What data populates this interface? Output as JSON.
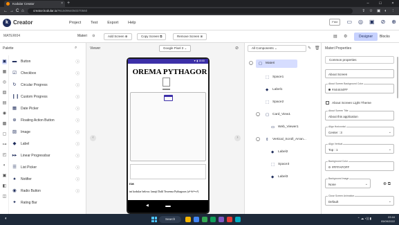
{
  "browser": {
    "tab_title": "Kodular Creator",
    "tab_close": "×",
    "new_tab": "+",
    "win_minimize": "–",
    "win_restore": "□",
    "win_close": "×",
    "back": "←",
    "forward": "→",
    "reload": "C",
    "home": "⌂",
    "url_host": "creator.kodular.io",
    "url_rest": "/#6150964050370560",
    "addr_icons": [
      "⇪",
      "☆",
      "▣",
      "◐",
      "⋮"
    ]
  },
  "app": {
    "logo_letter": "k",
    "brand": "Creator",
    "menu": [
      "Project",
      "Test",
      "Export",
      "Help"
    ],
    "free_badge": "Free",
    "header_icons": [
      "▭",
      "◎",
      "▣",
      "⊘",
      "⊕"
    ]
  },
  "toolbar": {
    "project_name": "MATERI04",
    "screen_name": "Materi",
    "screen_icon": "⊙",
    "add_screen": "Add Screen ⊕",
    "copy_screen": "Copy Screen ⧉",
    "remove_screen": "Remove Screen ⊗",
    "tool_icons": [
      "▤",
      "⚙"
    ],
    "designer": "Designer",
    "blocks": "Blocks"
  },
  "palette": {
    "title": "Palette",
    "search_icon": "⌕",
    "rail_icons": [
      "▣",
      "▦",
      "◎",
      "▨",
      "▤",
      "◉",
      "▩",
      "▢",
      "⊶",
      "◰",
      "◐",
      "▣",
      "◧",
      "◫"
    ],
    "help_icon": "ⓘ",
    "items": [
      {
        "icon": "▬",
        "label": "Button"
      },
      {
        "icon": "☑",
        "label": "Checkbox"
      },
      {
        "icon": "↻",
        "label": "Circular Progress"
      },
      {
        "icon": "❙❙",
        "label": "Custom Progress"
      },
      {
        "icon": "▦",
        "label": "Date Picker"
      },
      {
        "icon": "⊕",
        "label": "Floating Action Button"
      },
      {
        "icon": "▨",
        "label": "Image"
      },
      {
        "icon": "◆",
        "label": "Label"
      },
      {
        "icon": "▸▸",
        "label": "Linear Progressbar"
      },
      {
        "icon": "☰",
        "label": "List Picker"
      },
      {
        "icon": "♠",
        "label": "Notifier"
      },
      {
        "icon": "◉",
        "label": "Radio Button"
      },
      {
        "icon": "✦",
        "label": "Rating Bar"
      }
    ]
  },
  "viewer": {
    "title": "Viewer",
    "device": "Google Pixel 3 ⌄",
    "side_icon": "⊘",
    "scroll_left": "‹",
    "scroll_right": "›",
    "status_icons": "▼ ▮ 10:00",
    "screen_title": "OREMA PYTHAGOR",
    "text_heading": "ras",
    "text_body": "ini kodular belova. lanuji Dalil Teorema Pythagoras (a²+b²=c²)",
    "nav_back": "◀"
  },
  "components": {
    "title": "All Components ⌄",
    "edit_icon": "✎",
    "delete_icon": "🗑",
    "tree": [
      {
        "icon": "▢",
        "label": "Materi",
        "selected": true,
        "toggle": "–",
        "indent": 0
      },
      {
        "icon": "⬚",
        "label": "Space1",
        "selected": false,
        "toggle": "",
        "indent": 1
      },
      {
        "icon": "◆",
        "label": "Label1",
        "selected": false,
        "toggle": "",
        "indent": 1
      },
      {
        "icon": "⬚",
        "label": "Space2",
        "selected": false,
        "toggle": "",
        "indent": 1
      },
      {
        "icon": "▢",
        "label": "Card_View1",
        "selected": false,
        "toggle": "–",
        "indent": 1
      },
      {
        "icon": "▭",
        "label": "Web_Viewer1",
        "selected": false,
        "toggle": "",
        "indent": 2
      },
      {
        "icon": "⇕",
        "label": "Vertical_Scroll_Arran...",
        "selected": false,
        "toggle": "–",
        "indent": 1
      },
      {
        "icon": "◆",
        "label": "Label2",
        "selected": false,
        "toggle": "",
        "indent": 2
      },
      {
        "icon": "⬚",
        "label": "Space3",
        "selected": false,
        "toggle": "",
        "indent": 2
      },
      {
        "icon": "◆",
        "label": "Label3",
        "selected": false,
        "toggle": "",
        "indent": 2
      }
    ]
  },
  "properties": {
    "title": "Materi Properties",
    "section": "Common properties",
    "about_screen_value": "About Screen",
    "about_bg_label": "About Screen Background Color",
    "about_bg_value": "#444444FF",
    "about_bg_color": "#444444",
    "light_theme_label": "About Screen Light Theme",
    "title_label": "About Screen Title",
    "title_value": "About this application",
    "align_h_label": "Align Horizontal",
    "align_h_value": "Center : 3",
    "align_v_label": "Align Vertical",
    "align_v_value": "Top : 1",
    "bg_color_label": "Background Color",
    "bg_color_value": "#FFFAFOFF",
    "bg_color_swatch": "#FFFAF0",
    "bg_image_label": "Background Image",
    "bg_image_value": "None",
    "bg_image_icons": "⊕ ⧉",
    "close_anim_label": "Close Screen Animation",
    "close_anim_value": "Default",
    "caret": "⌄"
  },
  "taskbar": {
    "weather_icon": "◐",
    "search": "Search",
    "tray_icons": "⌃ ☁ ◖)) ▮",
    "time": "22:44",
    "date": "05/09/2022",
    "app_colors": [
      "#f4b400",
      "#4285f4",
      "#34a853",
      "#0f9d58",
      "#7e57c2",
      "#e53935",
      "#00acc1"
    ]
  },
  "accent": {
    "brand_dark": "#1f2d5c",
    "selected_bg": "#d6ddff",
    "phone_status": "#3c2fa8"
  }
}
